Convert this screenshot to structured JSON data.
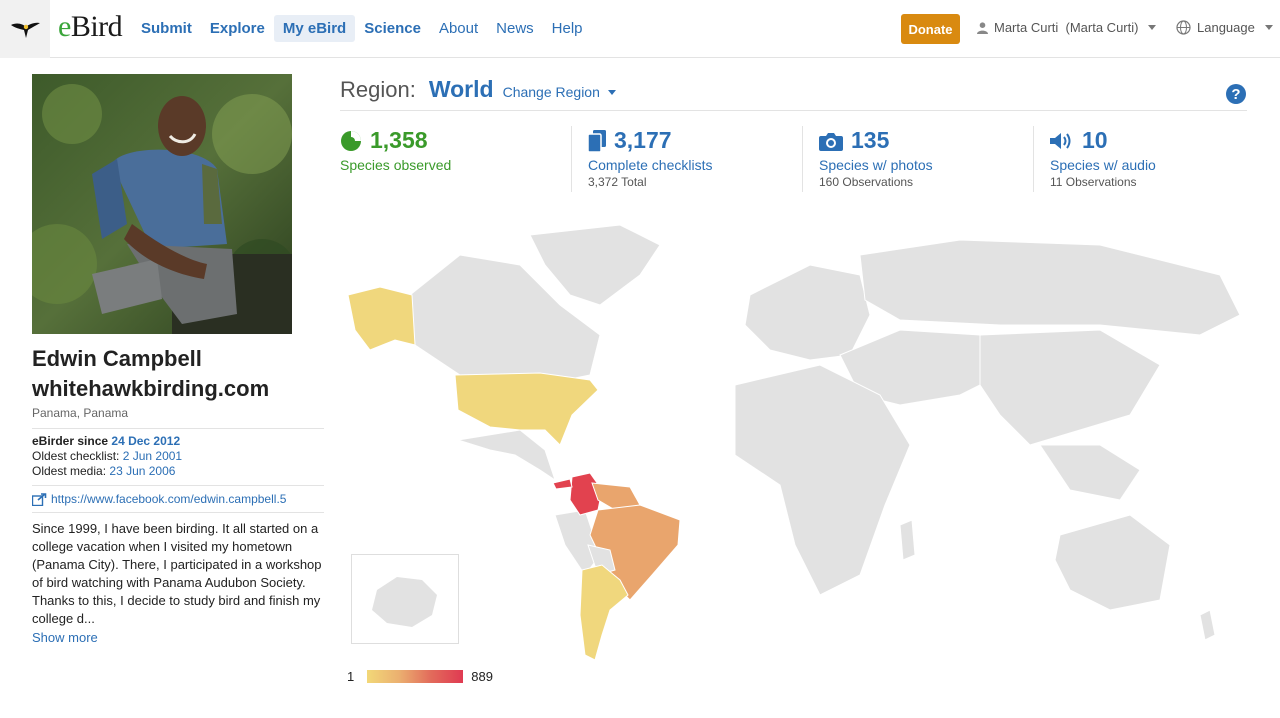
{
  "header": {
    "brand": "eBird",
    "nav": [
      {
        "label": "Submit",
        "bold": true
      },
      {
        "label": "Explore",
        "bold": true
      },
      {
        "label": "My eBird",
        "bold": true,
        "active": true
      },
      {
        "label": "Science",
        "bold": true
      },
      {
        "label": "About",
        "bold": false
      },
      {
        "label": "News",
        "bold": false
      },
      {
        "label": "Help",
        "bold": false
      }
    ],
    "donate": "Donate",
    "user": "Marta Curti  (Marta Curti)",
    "language": "Language"
  },
  "profile": {
    "name_line1": "Edwin Campbell",
    "name_line2": "whitehawkbirding.com",
    "location": "Panama, Panama",
    "ebirder_since_label": "eBirder since",
    "ebirder_since": "24 Dec 2012",
    "oldest_checklist_label": "Oldest checklist:",
    "oldest_checklist": "2 Jun 2001",
    "oldest_media_label": "Oldest media:",
    "oldest_media": "23 Jun 2006",
    "link": "https://www.facebook.com/edwin.campbell.5",
    "bio": "Since 1999, I have been birding. It all started on a college vacation when I visited my hometown (Panama City). There, I participated in a workshop of bird watching with Panama Audubon Society. Thanks to this, I decide to study bird and finish my college d...",
    "show_more": "Show more"
  },
  "region": {
    "label": "Region:",
    "value": "World",
    "change": "Change Region",
    "help": "?"
  },
  "stats": [
    {
      "value": "1,358",
      "label": "Species observed",
      "sub": "",
      "icon": "species-icon"
    },
    {
      "value": "3,177",
      "label": "Complete checklists",
      "sub": "3,372 Total",
      "icon": "checklist-icon"
    },
    {
      "value": "135",
      "label": "Species w/ photos",
      "sub": "160 Observations",
      "icon": "camera-icon"
    },
    {
      "value": "10",
      "label": "Species w/ audio",
      "sub": "11 Observations",
      "icon": "audio-icon"
    }
  ],
  "legend": {
    "min": "1",
    "max": "889"
  },
  "colors": {
    "link": "#2c6fb5",
    "green": "#3a9a2a",
    "donate": "#d98a10",
    "land": "#e2e2e2",
    "low": "#f2d878",
    "mid": "#eba56d",
    "high": "#e03a52"
  }
}
